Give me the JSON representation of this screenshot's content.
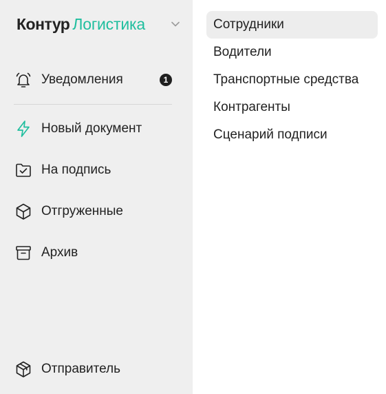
{
  "brand": {
    "name": "Контур",
    "product": "Логистика",
    "accent_color": "#1fbe9e"
  },
  "sidebar": {
    "items": [
      {
        "label": "Уведомления",
        "icon": "bell-icon",
        "badge": "1"
      },
      {
        "label": "Новый документ",
        "icon": "lightning-icon"
      },
      {
        "label": "На подпись",
        "icon": "folder-check-icon"
      },
      {
        "label": "Отгруженные",
        "icon": "box-icon"
      },
      {
        "label": "Архив",
        "icon": "archive-icon"
      }
    ],
    "footer": {
      "label": "Отправитель",
      "icon": "package-icon"
    }
  },
  "menu": {
    "items": [
      {
        "label": "Сотрудники",
        "active": true
      },
      {
        "label": "Водители"
      },
      {
        "label": "Транспортные средства"
      },
      {
        "label": "Контрагенты"
      },
      {
        "label": "Сценарий подписи"
      }
    ]
  }
}
